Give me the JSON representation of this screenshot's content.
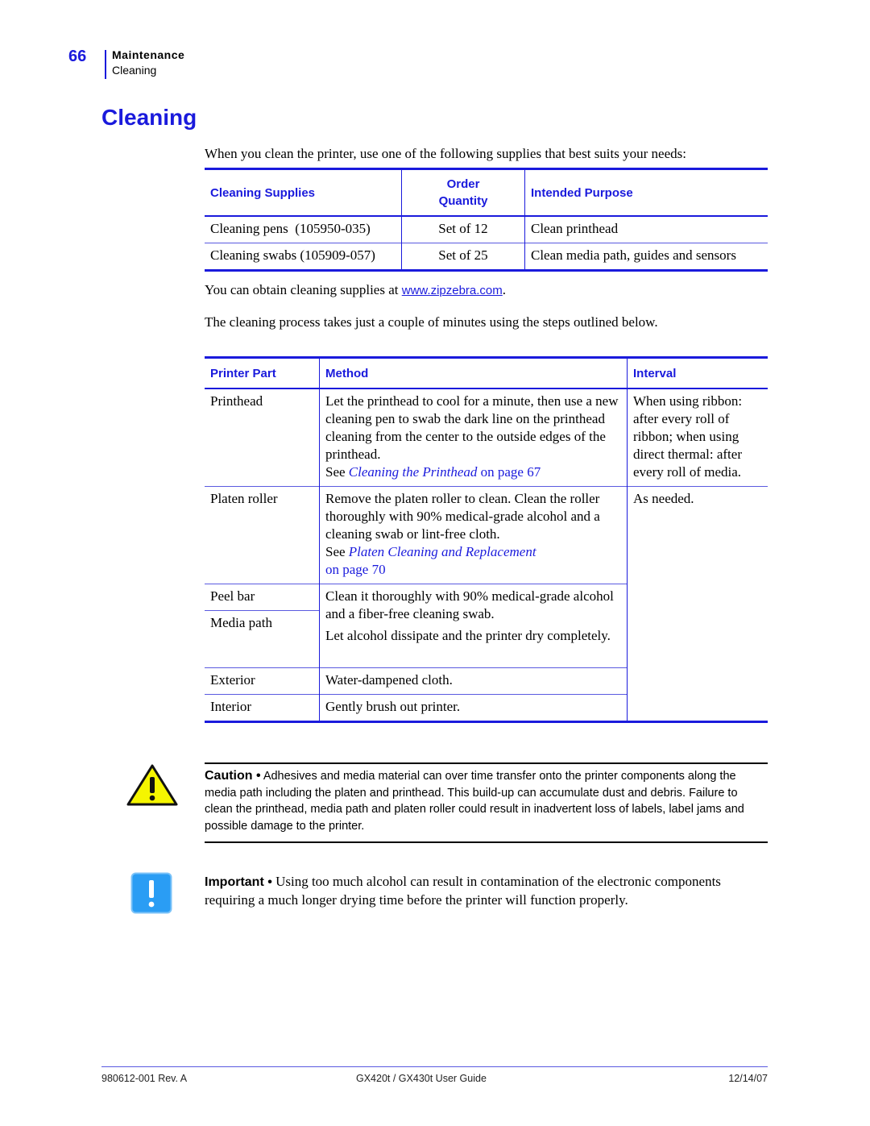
{
  "header": {
    "page_number": "66",
    "chapter": "Maintenance",
    "section": "Cleaning"
  },
  "title": "Cleaning",
  "intro": "When you clean the printer, use one of the following supplies that best suits your needs:",
  "supplies_table": {
    "headers": [
      "Cleaning Supplies",
      "Order Quantity",
      "Intended Purpose"
    ],
    "header_order_line1": "Order",
    "header_order_line2": "Quantity",
    "rows": [
      {
        "supply": "Cleaning pens  (105950-035)",
        "quantity": "Set of 12",
        "purpose": "Clean printhead"
      },
      {
        "supply": "Cleaning swabs (105909-057)",
        "quantity": "Set of 25",
        "purpose": "Clean media path, guides and sensors"
      }
    ]
  },
  "obtain": {
    "prefix": "You can obtain cleaning supplies at ",
    "link": "www.zipzebra.com",
    "suffix": "."
  },
  "process_text": "The cleaning process takes just a couple of minutes using the steps outlined below.",
  "cleaning_table": {
    "headers": [
      "Printer Part",
      "Method",
      "Interval"
    ],
    "rows": {
      "printhead": {
        "part": "Printhead",
        "method": "Let the printhead to cool for a minute, then use a new cleaning pen to swab the dark line on the printhead cleaning from the center to the outside edges of the printhead.",
        "see": "See ",
        "ref": "Cleaning the Printhead",
        "ref_page": " on page 67",
        "interval": "When using ribbon: after every roll of ribbon; when using direct thermal: after every roll of media."
      },
      "platen": {
        "part": "Platen roller",
        "method": "Remove the platen roller to clean. Clean the roller thoroughly with 90% medical-grade alcohol and a cleaning swab or lint-free cloth.",
        "see": "See ",
        "ref": "Platen Cleaning and Replacement",
        "ref_page": "on page 70",
        "interval": "As needed."
      },
      "peel_bar": {
        "part": "Peel bar"
      },
      "media_path": {
        "part": "Media path"
      },
      "shared_method": "Clean it thoroughly with 90% medical-grade alcohol and a fiber-free cleaning swab.",
      "shared_method_2": "Let alcohol dissipate and the printer dry completely.",
      "exterior": {
        "part": "Exterior",
        "method": "Water-dampened cloth."
      },
      "interior": {
        "part": "Interior",
        "method": "Gently brush out printer."
      }
    }
  },
  "caution": {
    "label": "Caution •",
    "text": " Adhesives and media material can over time transfer onto the printer components along the media path including the platen and printhead. This build-up can accumulate dust and debris. Failure to clean the printhead, media path and platen roller could result in inadvertent loss of labels, label jams and possible damage to the printer.",
    "icon": "warning-triangle-icon"
  },
  "important": {
    "label": "Important •",
    "text": " Using too much alcohol can result in contamination of the electronic components requiring a much longer drying time before the printer will function properly.",
    "icon": "exclamation-box-icon"
  },
  "footer": {
    "doc_number": "980612-001 Rev. A",
    "guide_title": "GX420t / GX430t User Guide",
    "date": "12/14/07"
  },
  "colors": {
    "accent": "#1a1adc",
    "warning_yellow": "#f5f500",
    "important_blue": "#2a9df4"
  }
}
